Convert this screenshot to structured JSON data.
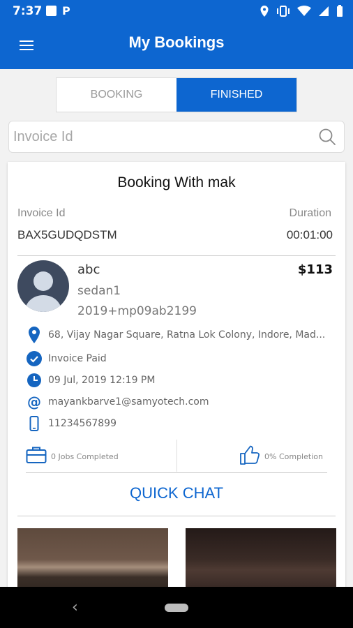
{
  "status": {
    "time": "7:37"
  },
  "appbar": {
    "title": "My Bookings"
  },
  "tabs": [
    {
      "label": "BOOKING",
      "active": false
    },
    {
      "label": "FINISHED",
      "active": true
    }
  ],
  "search": {
    "placeholder": "Invoice Id"
  },
  "booking": {
    "title": "Booking With mak",
    "invoice_label": "Invoice Id",
    "invoice_value": "BAX5GUDQDSTM",
    "duration_label": "Duration",
    "duration_value": "00:01:00",
    "driver": {
      "name": "abc",
      "car": "sedan1",
      "plate": "2019+mp09ab2199"
    },
    "price": "$113",
    "address": "68, Vijay Nagar Square, Ratna Lok Colony, Indore, Mad...",
    "payment_status": "Invoice Paid",
    "datetime": "09 Jul, 2019 12:19 PM",
    "email": "mayankbarve1@samyotech.com",
    "phone": "11234567899",
    "jobs_completed": "0 Jobs Completed",
    "completion": "0% Completion",
    "quick_chat": "QUICK CHAT"
  },
  "colors": {
    "primary": "#0d66d0",
    "icon_blue": "#1565c0"
  },
  "icons": [
    "menu-icon",
    "search-icon",
    "location-pin-icon",
    "check-circle-icon",
    "clock-icon",
    "at-sign-icon",
    "phone-icon",
    "briefcase-icon",
    "thumbs-up-icon"
  ]
}
